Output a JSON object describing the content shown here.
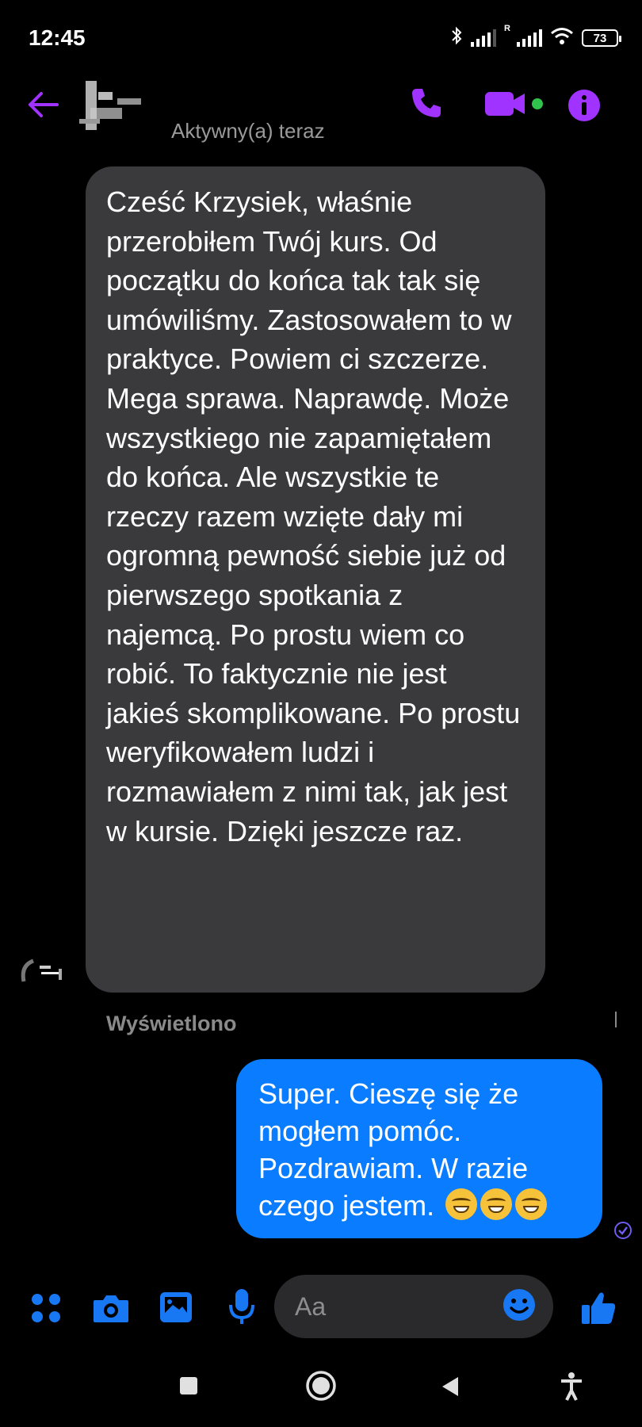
{
  "status_bar": {
    "time": "12:45",
    "battery": "73",
    "icons": [
      "bluetooth-icon",
      "signal-icon",
      "signal-r-icon",
      "wifi-icon",
      "battery-icon"
    ]
  },
  "header": {
    "active_status": "Aktywny(a) teraz",
    "accent_color": "#a033ff"
  },
  "messages": {
    "incoming": "Cześć Krzysiek, właśnie przerobiłem Twój kurs. Od początku do końca tak tak się umówiliśmy. Zastosowałem to w praktyce. Powiem ci szczerze. Mega sprawa. Naprawdę. Może wszystkiego nie zapamiętałem do końca. Ale wszystkie te rzeczy razem wzięte dały mi ogromną pewność siebie już od pierwszego spotkania z najemcą. Po prostu wiem co robić. To faktycznie nie jest jakieś skomplikowane. Po prostu weryfikowałem ludzi i rozmawiałem z nimi tak, jak jest w kursie. Dzięki jeszcze raz.",
    "seen_label": "Wyświetlono",
    "outgoing": "Super. Cieszę się że mogłem pomóc. Pozdrawiam. W razie czego jestem.",
    "outgoing_color": "#0a7cff"
  },
  "composer": {
    "placeholder": "Aa",
    "icon_color": "#1877f2"
  }
}
